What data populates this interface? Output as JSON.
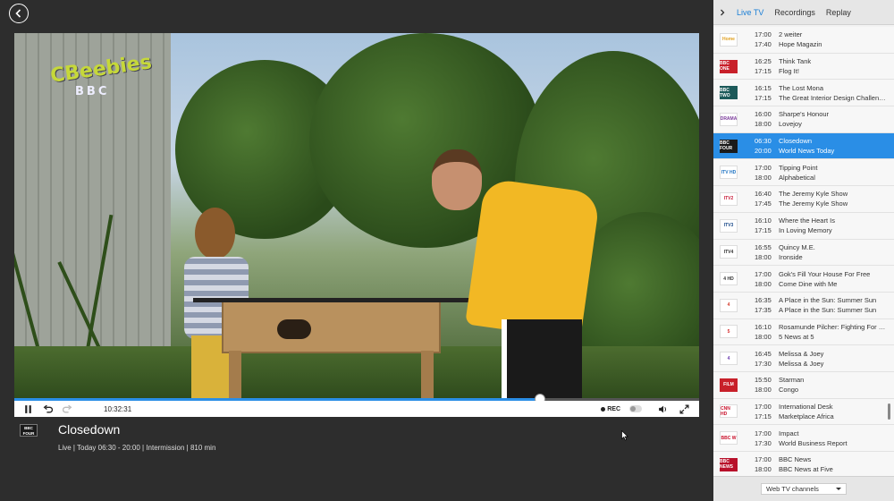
{
  "player": {
    "time": "10:32:31",
    "progress": 0.768,
    "rec_label": "REC",
    "video_logo_text": "CBeebies",
    "video_logo_sub": "BBC"
  },
  "program": {
    "channel_logo": "BBC FOUR",
    "title": "Closedown",
    "meta": "Live | Today 06:30 - 20:00 | Intermission | 810 min"
  },
  "sidebar": {
    "tabs": [
      {
        "label": "Live TV",
        "active": true
      },
      {
        "label": "Recordings",
        "active": false
      },
      {
        "label": "Replay",
        "active": false
      }
    ],
    "channels": [
      {
        "logo": "Home",
        "logo_color": "#ffffff",
        "logo_text_color": "#e0a020",
        "t1": "17:00",
        "p1": "2 weiter",
        "t2": "17:40",
        "p2": "Hope Magazin"
      },
      {
        "logo": "BBC ONE",
        "logo_color": "#c8202a",
        "logo_text_color": "#ffffff",
        "t1": "16:25",
        "p1": "Think Tank",
        "t2": "17:15",
        "p2": "Flog It!"
      },
      {
        "logo": "BBC TWO",
        "logo_color": "#1c5a5a",
        "logo_text_color": "#ffffff",
        "t1": "16:15",
        "p1": "The Lost Mona",
        "t2": "17:15",
        "p2": "The Great Interior Design Challenge"
      },
      {
        "logo": "DRAMA",
        "logo_color": "#ffffff",
        "logo_text_color": "#7a3a9a",
        "t1": "16:00",
        "p1": "Sharpe's Honour",
        "t2": "18:00",
        "p2": "Lovejoy"
      },
      {
        "logo": "BBC FOUR",
        "logo_color": "#1a1a1a",
        "logo_text_color": "#ffffff",
        "t1": "06:30",
        "p1": "Closedown",
        "t2": "20:00",
        "p2": "World News Today",
        "active": true
      },
      {
        "logo": "ITV HD",
        "logo_color": "#ffffff",
        "logo_text_color": "#1a70c0",
        "t1": "17:00",
        "p1": "Tipping Point",
        "t2": "18:00",
        "p2": "Alphabetical"
      },
      {
        "logo": "ITV2",
        "logo_color": "#ffffff",
        "logo_text_color": "#c81e3a",
        "t1": "16:40",
        "p1": "The Jeremy Kyle Show",
        "t2": "17:45",
        "p2": "The Jeremy Kyle Show"
      },
      {
        "logo": "ITV3",
        "logo_color": "#ffffff",
        "logo_text_color": "#1a4a8a",
        "t1": "16:10",
        "p1": "Where the Heart Is",
        "t2": "17:15",
        "p2": "In Loving Memory"
      },
      {
        "logo": "ITV4",
        "logo_color": "#ffffff",
        "logo_text_color": "#333333",
        "t1": "16:55",
        "p1": "Quincy M.E.",
        "t2": "18:00",
        "p2": "Ironside"
      },
      {
        "logo": "4 HD",
        "logo_color": "#ffffff",
        "logo_text_color": "#333333",
        "t1": "17:00",
        "p1": "Gok's Fill Your House For Free",
        "t2": "18:00",
        "p2": "Come Dine with Me"
      },
      {
        "logo": "4",
        "logo_color": "#ffffff",
        "logo_text_color": "#d43a2a",
        "t1": "16:35",
        "p1": "A Place in the Sun: Summer Sun",
        "t2": "17:35",
        "p2": "A Place in the Sun: Summer Sun"
      },
      {
        "logo": "5",
        "logo_color": "#ffffff",
        "logo_text_color": "#d42a2a",
        "t1": "16:10",
        "p1": "Rosamunde Pilcher: Fighting For Love",
        "t2": "18:00",
        "p2": "5 News at 5"
      },
      {
        "logo": "4",
        "logo_color": "#ffffff",
        "logo_text_color": "#6a3ab0",
        "t1": "16:45",
        "p1": "Melissa & Joey",
        "t2": "17:30",
        "p2": "Melissa & Joey"
      },
      {
        "logo": "FILM",
        "logo_color": "#c8202a",
        "logo_text_color": "#ffffff",
        "t1": "15:50",
        "p1": "Starman",
        "t2": "18:00",
        "p2": "Congo"
      },
      {
        "logo": "CNN HD",
        "logo_color": "#ffffff",
        "logo_text_color": "#c8102a",
        "t1": "17:00",
        "p1": "International Desk",
        "t2": "17:15",
        "p2": "Marketplace Africa"
      },
      {
        "logo": "BBC W",
        "logo_color": "#ffffff",
        "logo_text_color": "#c8102a",
        "t1": "17:00",
        "p1": "Impact",
        "t2": "17:30",
        "p2": "World Business Report"
      },
      {
        "logo": "BBC NEWS",
        "logo_color": "#b8102a",
        "logo_text_color": "#ffffff",
        "t1": "17:00",
        "p1": "BBC News",
        "t2": "18:00",
        "p2": "BBC News at Five"
      }
    ],
    "dropdown_label": "Web TV channels"
  }
}
